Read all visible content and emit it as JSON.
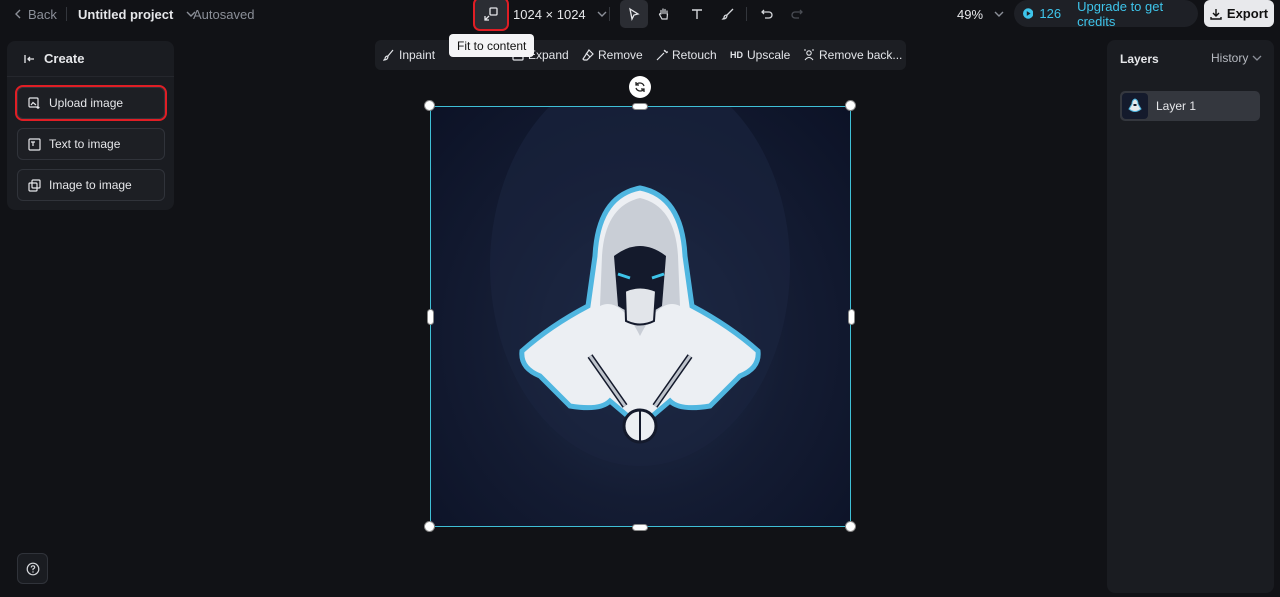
{
  "header": {
    "back_label": "Back",
    "project_title": "Untitled project",
    "save_status": "Autosaved",
    "canvas_size": "1024 × 1024",
    "zoom": "49%",
    "credits": "126",
    "upgrade_label": "Upgrade to get credits",
    "export_label": "Export",
    "tooltip": "Fit to content"
  },
  "left_panel": {
    "title": "Create",
    "items": [
      {
        "label": "Upload image",
        "icon": "upload-image-icon"
      },
      {
        "label": "Text to image",
        "icon": "text-to-image-icon"
      },
      {
        "label": "Image to image",
        "icon": "image-to-image-icon"
      }
    ]
  },
  "toolstrip": {
    "items": [
      {
        "label": "Inpaint",
        "icon": "inpaint-brush-icon"
      },
      {
        "label": "Expand",
        "icon": "expand-icon"
      },
      {
        "label": "Remove",
        "icon": "eraser-icon"
      },
      {
        "label": "Retouch",
        "icon": "magic-wand-icon"
      },
      {
        "label": "Upscale",
        "icon": "hd-icon",
        "icon_text": "HD"
      },
      {
        "label": "Remove back...",
        "icon": "remove-background-icon"
      }
    ]
  },
  "right_panel": {
    "layers_title": "Layers",
    "history_label": "History",
    "layers": [
      {
        "label": "Layer 1"
      }
    ]
  },
  "colors": {
    "accent": "#3ec4ea",
    "selection": "#3fbfd6",
    "highlight": "#e01e25",
    "background": "#111216"
  }
}
